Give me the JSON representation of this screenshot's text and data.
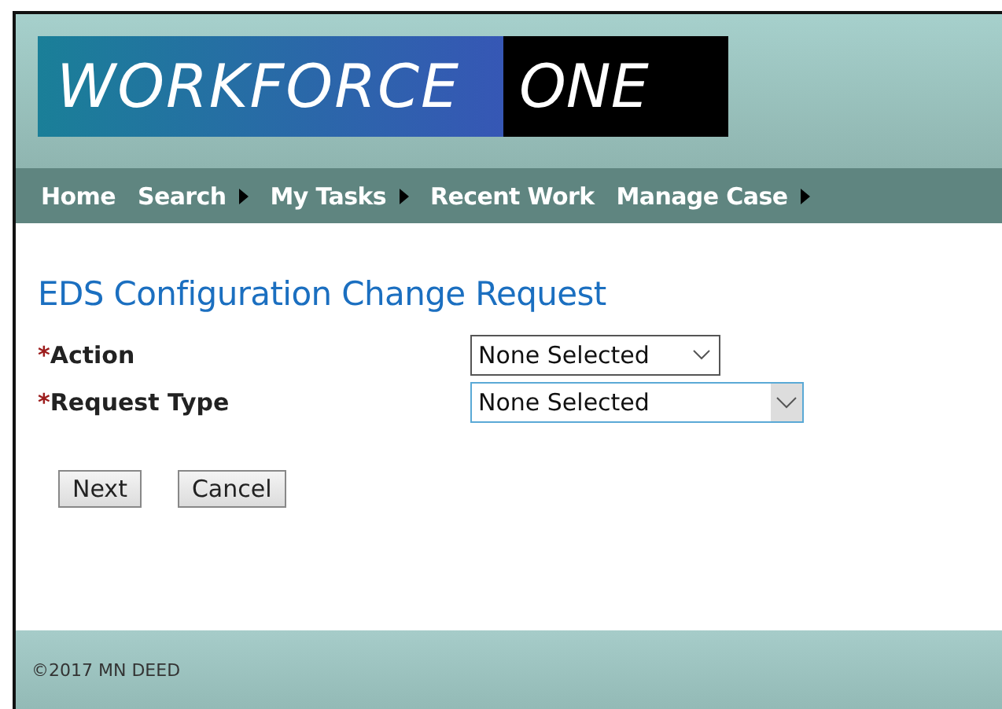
{
  "logo": {
    "word_1": "WORKFORCE",
    "word_2": "ONE"
  },
  "nav": [
    {
      "label": "Home",
      "has_submenu": false
    },
    {
      "label": "Search",
      "has_submenu": true
    },
    {
      "label": "My Tasks",
      "has_submenu": true
    },
    {
      "label": "Recent Work",
      "has_submenu": false
    },
    {
      "label": "Manage Case",
      "has_submenu": true
    }
  ],
  "page_title": "EDS Configuration Change Request",
  "fields": [
    {
      "required_mark": "*",
      "label": "Action",
      "value": "None Selected",
      "focused": false
    },
    {
      "required_mark": "*",
      "label": "Request Type",
      "value": "None Selected",
      "focused": true
    }
  ],
  "buttons": [
    "Next",
    "Cancel"
  ],
  "footer": "©2017 MN DEED"
}
